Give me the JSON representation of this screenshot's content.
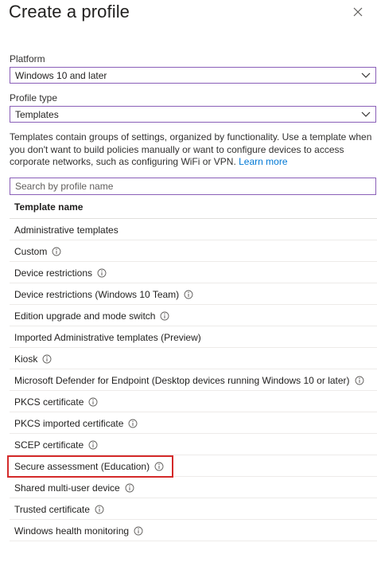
{
  "panel": {
    "title": "Create a profile"
  },
  "platform": {
    "label": "Platform",
    "value": "Windows 10 and later"
  },
  "profile_type": {
    "label": "Profile type",
    "value": "Templates"
  },
  "description": {
    "text": "Templates contain groups of settings, organized by functionality. Use a template when you don't want to build policies manually or want to configure devices to access corporate networks, such as configuring WiFi or VPN.",
    "link": "Learn more"
  },
  "search": {
    "placeholder": "Search by profile name"
  },
  "table": {
    "header": "Template name",
    "rows": [
      {
        "name": "Administrative templates",
        "info": false
      },
      {
        "name": "Custom",
        "info": true
      },
      {
        "name": "Device restrictions",
        "info": true
      },
      {
        "name": "Device restrictions (Windows 10 Team)",
        "info": true
      },
      {
        "name": "Edition upgrade and mode switch",
        "info": true
      },
      {
        "name": "Imported Administrative templates (Preview)",
        "info": false
      },
      {
        "name": "Kiosk",
        "info": true
      },
      {
        "name": "Microsoft Defender for Endpoint (Desktop devices running Windows 10 or later)",
        "info": true
      },
      {
        "name": "PKCS certificate",
        "info": true
      },
      {
        "name": "PKCS imported certificate",
        "info": true
      },
      {
        "name": "SCEP certificate",
        "info": true
      },
      {
        "name": "Secure assessment (Education)",
        "info": true
      },
      {
        "name": "Shared multi-user device",
        "info": true
      },
      {
        "name": "Trusted certificate",
        "info": true
      },
      {
        "name": "Windows health monitoring",
        "info": true
      }
    ]
  },
  "colors": {
    "accent_border": "#8a5fb8",
    "link": "#0078d4",
    "highlight": "#d42a2a"
  }
}
